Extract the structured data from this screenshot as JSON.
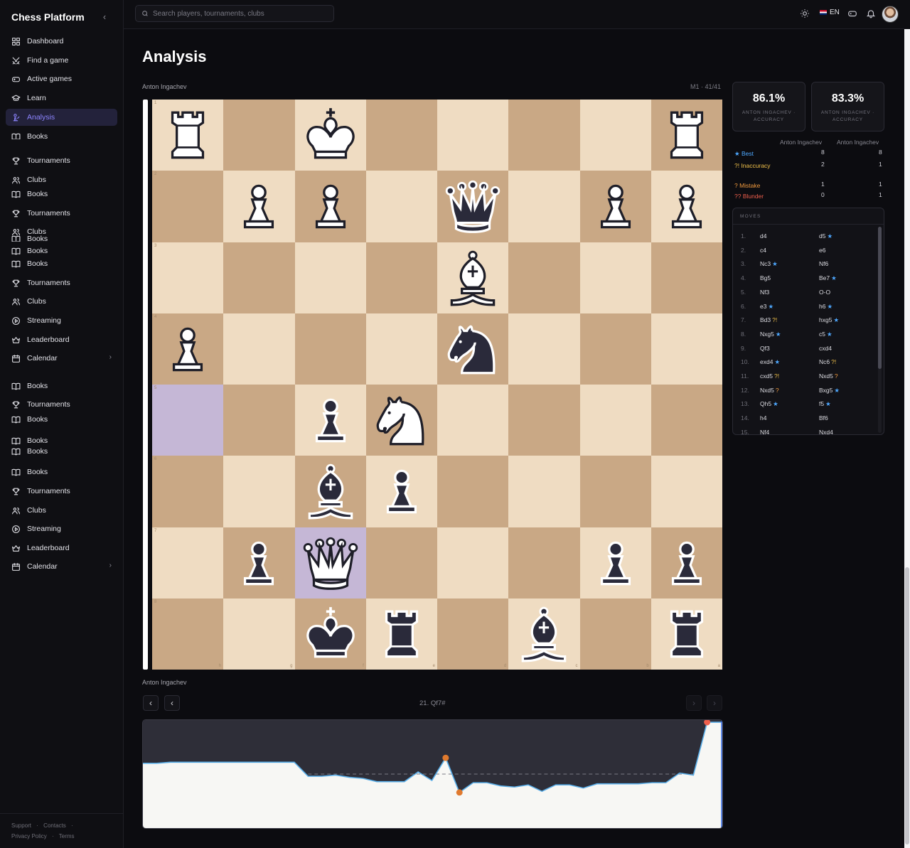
{
  "app": {
    "title": "Chess Platform"
  },
  "search": {
    "placeholder": "Search players, tournaments, clubs"
  },
  "topbar": {
    "language": "EN"
  },
  "sidebar": {
    "items": [
      {
        "label": "Dashboard",
        "icon": "dashboard-icon"
      },
      {
        "label": "Find a game",
        "icon": "swords-icon"
      },
      {
        "label": "Active games",
        "icon": "gamepad-icon"
      },
      {
        "label": "Learn",
        "icon": "graduation-cap-icon"
      },
      {
        "label": "Analysis",
        "icon": "analysis-icon"
      },
      {
        "label": "Books",
        "icon": "book-icon"
      },
      {
        "label": "Books",
        "icon": "book-icon"
      },
      {
        "label": "Tournaments",
        "icon": "trophy-icon"
      },
      {
        "label": "Clubs",
        "icon": "users-icon"
      },
      {
        "label": "Books",
        "icon": "book-icon"
      },
      {
        "label": "Tournaments",
        "icon": "trophy-icon"
      },
      {
        "label": "Clubs",
        "icon": "users-icon"
      },
      {
        "label": "Books",
        "icon": "book-icon"
      },
      {
        "label": "Books",
        "icon": "book-icon"
      },
      {
        "label": "Books",
        "icon": "book-icon"
      },
      {
        "label": "Tournaments",
        "icon": "trophy-icon"
      },
      {
        "label": "Clubs",
        "icon": "users-icon"
      },
      {
        "label": "Streaming",
        "icon": "play-circle-icon"
      },
      {
        "label": "Leaderboard",
        "icon": "crown-icon"
      },
      {
        "label": "Calendar",
        "icon": "calendar-icon"
      },
      {
        "label": "Books",
        "icon": "book-icon"
      },
      {
        "label": "Tournaments",
        "icon": "trophy-icon"
      },
      {
        "label": "Books",
        "icon": "book-icon"
      },
      {
        "label": "Books",
        "icon": "book-icon"
      },
      {
        "label": "Books",
        "icon": "book-icon"
      },
      {
        "label": "Books",
        "icon": "book-icon"
      },
      {
        "label": "Tournaments",
        "icon": "trophy-icon"
      },
      {
        "label": "Clubs",
        "icon": "users-icon"
      },
      {
        "label": "Streaming",
        "icon": "play-circle-icon"
      },
      {
        "label": "Leaderboard",
        "icon": "crown-icon"
      },
      {
        "label": "Calendar",
        "icon": "calendar-icon"
      }
    ],
    "footer": {
      "support": "Support",
      "contacts": "Contacts",
      "privacy": "Privacy Policy",
      "terms": "Terms",
      "sep": "·"
    }
  },
  "page": {
    "title": "Analysis"
  },
  "analysis": {
    "top_player": "Anton Ingachev",
    "bottom_player": "Anton Ingachev",
    "position_info": "M1 · 41/41",
    "current_move": "21. Qf7#",
    "eval_white_fraction": 0.99
  },
  "board": {
    "ranks": [
      "1",
      "2",
      "3",
      "4",
      "5",
      "6",
      "7",
      "8"
    ],
    "files": [
      "h",
      "g",
      "f",
      "e",
      "d",
      "c",
      "b",
      "a"
    ],
    "light": "#efdcc2",
    "dark": "#c9a885",
    "highlight": "#c5b7d6",
    "highlights": [
      [
        4,
        0
      ],
      [
        6,
        2
      ]
    ],
    "pieces": [
      [
        0,
        0,
        "w",
        "rook"
      ],
      [
        0,
        2,
        "w",
        "king"
      ],
      [
        0,
        7,
        "w",
        "rook"
      ],
      [
        1,
        1,
        "w",
        "pawn"
      ],
      [
        1,
        2,
        "w",
        "pawn"
      ],
      [
        1,
        4,
        "b",
        "queen"
      ],
      [
        1,
        6,
        "w",
        "pawn"
      ],
      [
        1,
        7,
        "w",
        "pawn"
      ],
      [
        2,
        4,
        "w",
        "bishop"
      ],
      [
        3,
        0,
        "w",
        "pawn"
      ],
      [
        3,
        4,
        "b",
        "knight"
      ],
      [
        4,
        2,
        "b",
        "pawn"
      ],
      [
        4,
        3,
        "w",
        "knight"
      ],
      [
        5,
        2,
        "b",
        "bishop"
      ],
      [
        5,
        3,
        "b",
        "pawn"
      ],
      [
        6,
        1,
        "b",
        "pawn"
      ],
      [
        6,
        2,
        "w",
        "queen"
      ],
      [
        6,
        6,
        "b",
        "pawn"
      ],
      [
        6,
        7,
        "b",
        "pawn"
      ],
      [
        7,
        2,
        "b",
        "king"
      ],
      [
        7,
        3,
        "b",
        "rook"
      ],
      [
        7,
        5,
        "b",
        "bishop"
      ],
      [
        7,
        7,
        "b",
        "rook"
      ]
    ]
  },
  "accuracy": [
    {
      "value": "86.1%",
      "label": "ANTON INGACHEV · ACCURACY"
    },
    {
      "value": "83.3%",
      "label": "ANTON INGACHEV · ACCURACY"
    }
  ],
  "summary": {
    "players": [
      "Anton Ingachev",
      "Anton Ingachev"
    ],
    "rows": [
      {
        "label": "★ Best",
        "w": "8",
        "b": "8",
        "color": "#4ea8ff"
      },
      {
        "label": "?! Inaccuracy",
        "w": "2",
        "b": "1",
        "color": "#f1c14a"
      },
      {
        "label": "? Mistake",
        "w": "1",
        "b": "1",
        "color": "#f19a3e"
      },
      {
        "label": "?? Blunder",
        "w": "0",
        "b": "1",
        "color": "#ef5f4c"
      }
    ]
  },
  "moves": {
    "header": "MOVES",
    "list": [
      {
        "n": "1.",
        "w": "d4",
        "wm": "",
        "b": "d5",
        "bm": "★"
      },
      {
        "n": "2.",
        "w": "c4",
        "wm": "",
        "b": "e6",
        "bm": ""
      },
      {
        "n": "3.",
        "w": "Nc3",
        "wm": "★",
        "b": "Nf6",
        "bm": ""
      },
      {
        "n": "4.",
        "w": "Bg5",
        "wm": "",
        "b": "Be7",
        "bm": "★"
      },
      {
        "n": "5.",
        "w": "Nf3",
        "wm": "",
        "b": "O-O",
        "bm": ""
      },
      {
        "n": "6.",
        "w": "e3",
        "wm": "★",
        "b": "h6",
        "bm": "★"
      },
      {
        "n": "7.",
        "w": "Bd3",
        "wm": "?!",
        "b": "hxg5",
        "bm": "★"
      },
      {
        "n": "8.",
        "w": "Nxg5",
        "wm": "★",
        "b": "c5",
        "bm": "★"
      },
      {
        "n": "9.",
        "w": "Qf3",
        "wm": "",
        "b": "cxd4",
        "bm": ""
      },
      {
        "n": "10.",
        "w": "exd4",
        "wm": "★",
        "b": "Nc6",
        "bm": "?!"
      },
      {
        "n": "11.",
        "w": "cxd5",
        "wm": "?!",
        "b": "Nxd5",
        "bm": "?"
      },
      {
        "n": "12.",
        "w": "Nxd5",
        "wm": "?",
        "b": "Bxg5",
        "bm": "★"
      },
      {
        "n": "13.",
        "w": "Qh5",
        "wm": "★",
        "b": "f5",
        "bm": "★"
      },
      {
        "n": "14.",
        "w": "h4",
        "wm": "",
        "b": "Bf6",
        "bm": ""
      },
      {
        "n": "15.",
        "w": "Nf4",
        "wm": "",
        "b": "Nxd4",
        "bm": ""
      }
    ]
  },
  "eval_graph": {
    "values": [
      0.6,
      0.6,
      0.61,
      0.61,
      0.61,
      0.61,
      0.61,
      0.61,
      0.61,
      0.61,
      0.61,
      0.61,
      0.48,
      0.48,
      0.49,
      0.47,
      0.46,
      0.43,
      0.43,
      0.43,
      0.52,
      0.44,
      0.65,
      0.33,
      0.42,
      0.42,
      0.39,
      0.38,
      0.4,
      0.34,
      0.4,
      0.4,
      0.37,
      0.41,
      0.41,
      0.41,
      0.41,
      0.42,
      0.42,
      0.51,
      0.49,
      0.98,
      0.98
    ],
    "markers": [
      [
        22,
        "#e07a2e"
      ],
      [
        23,
        "#e07a2e"
      ],
      [
        41,
        "#ef5f4c"
      ]
    ]
  }
}
